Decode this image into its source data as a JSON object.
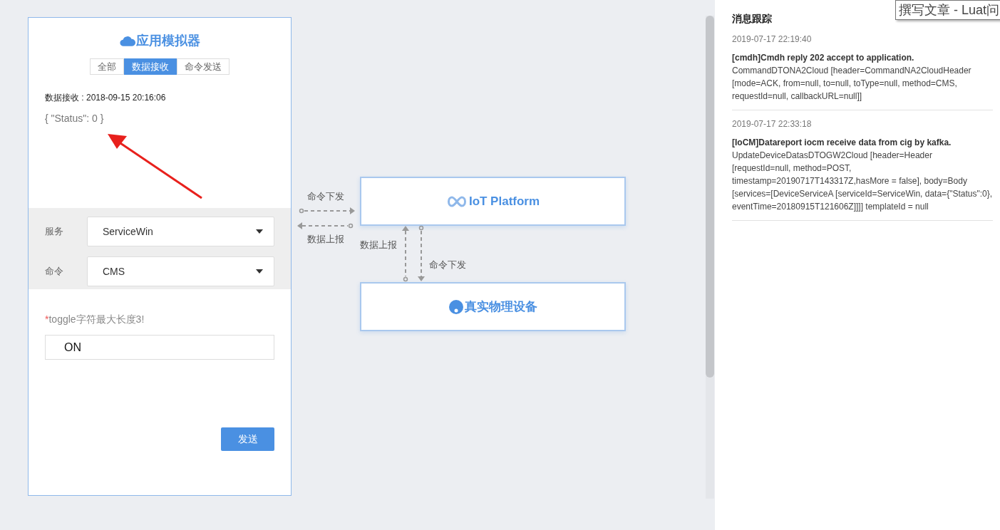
{
  "simulator": {
    "title": "应用模拟器",
    "tabs": [
      {
        "label": "全部",
        "selected": false
      },
      {
        "label": "数据接收",
        "selected": true
      },
      {
        "label": "命令发送",
        "selected": false
      }
    ],
    "received_label": "数据接收 : 2018-09-15 20:16:06",
    "received_data": "{ \"Status\": 0 }",
    "fields": [
      {
        "label": "服务",
        "value": "ServiceWin"
      },
      {
        "label": "命令",
        "value": "CMS"
      }
    ],
    "required_mark": "*",
    "hint": "toggle字符最大长度3!",
    "input_value": "ON",
    "send_button": "发送"
  },
  "diagram": {
    "platform": "IoT Platform",
    "device": "真实物理设备",
    "left_down_label": "命令下发",
    "left_up_label": "数据上报",
    "vertical_up_label": "数据上报",
    "vertical_down_label": "命令下发"
  },
  "trace": {
    "title": "消息跟踪",
    "messages": [
      {
        "time": "2019-07-17 22:19:40",
        "title": "[cmdh]Cmdh reply 202 accept to application.",
        "body": "CommandDTONA2Cloud [header=CommandNA2CloudHeader [mode=ACK, from=null, to=null, toType=null, method=CMS, requestId=null, callbackURL=null]]"
      },
      {
        "time": "2019-07-17 22:33:18",
        "title": "[IoCM]Datareport iocm receive data from cig by kafka.",
        "body": "UpdateDeviceDatasDTOGW2Cloud [header=Header [requestId=null, method=POST, timestamp=20190717T143317Z,hasMore = false], body=Body [services=[DeviceServiceA [serviceId=ServiceWin, data={\"Status\":0}, eventTime=20180915T121606Z]]]] templateId = null"
      }
    ]
  },
  "tooltip": "撰写文章 - Luat问"
}
